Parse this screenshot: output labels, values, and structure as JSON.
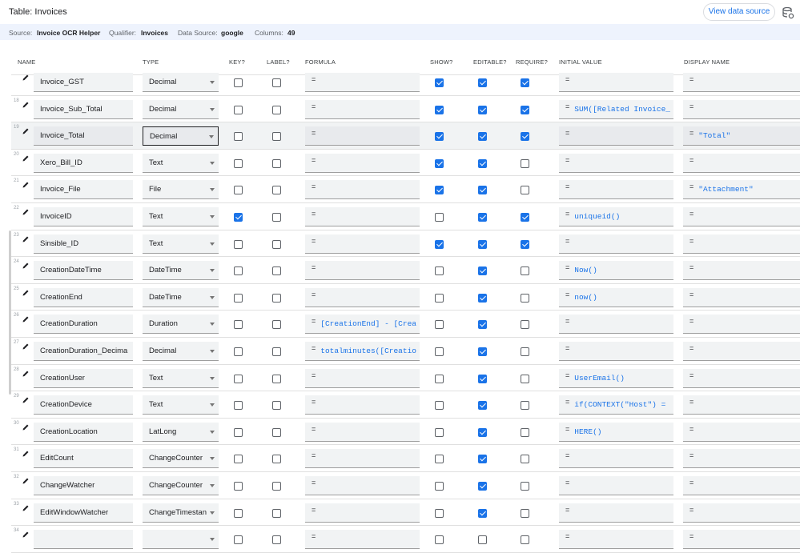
{
  "header": {
    "title": "Table: Invoices",
    "view_data_source": "View data source"
  },
  "info": {
    "source_label": "Source:",
    "source_value": "Invoice OCR Helper",
    "qualifier_label": "Qualifier:",
    "qualifier_value": "Invoices",
    "datasource_label": "Data Source:",
    "datasource_value": "google",
    "columns_label": "Columns:",
    "columns_value": "49"
  },
  "columns": {
    "name": "NAME",
    "type": "TYPE",
    "key": "KEY?",
    "label": "LABEL?",
    "formula": "FORMULA",
    "show": "SHOW?",
    "editable": "EDITABLE?",
    "require": "REQUIRE?",
    "initial": "INITIAL VALUE",
    "display": "DISPLAY NAME"
  },
  "rows": [
    {
      "num": "",
      "name": "Invoice_GST",
      "type": "Decimal",
      "key": false,
      "label": false,
      "formula": "",
      "show": true,
      "editable": true,
      "require": true,
      "initial": "",
      "display": ""
    },
    {
      "num": "18",
      "name": "Invoice_Sub_Total",
      "type": "Decimal",
      "key": false,
      "label": false,
      "formula": "",
      "show": true,
      "editable": true,
      "require": true,
      "initial": "SUM([Related Invoice_",
      "display": ""
    },
    {
      "num": "19",
      "name": "Invoice_Total",
      "type": "Decimal",
      "key": false,
      "label": false,
      "formula": "",
      "show": true,
      "editable": true,
      "require": true,
      "initial": "",
      "display": "\"Total\""
    },
    {
      "num": "20",
      "name": "Xero_Bill_ID",
      "type": "Text",
      "key": false,
      "label": false,
      "formula": "",
      "show": true,
      "editable": true,
      "require": false,
      "initial": "",
      "display": ""
    },
    {
      "num": "21",
      "name": "Invoice_File",
      "type": "File",
      "key": false,
      "label": false,
      "formula": "",
      "show": true,
      "editable": true,
      "require": false,
      "initial": "",
      "display": "\"Attachment\""
    },
    {
      "num": "22",
      "name": "InvoiceID",
      "type": "Text",
      "key": true,
      "label": false,
      "formula": "",
      "show": false,
      "editable": true,
      "require": true,
      "initial": "uniqueid()",
      "display": ""
    },
    {
      "num": "23",
      "name": "Sinsible_ID",
      "type": "Text",
      "key": false,
      "label": false,
      "formula": "",
      "show": true,
      "editable": true,
      "require": true,
      "initial": "",
      "display": ""
    },
    {
      "num": "24",
      "name": "CreationDateTime",
      "type": "DateTime",
      "key": false,
      "label": false,
      "formula": "",
      "show": false,
      "editable": true,
      "require": false,
      "initial": "Now()",
      "display": ""
    },
    {
      "num": "25",
      "name": "CreationEnd",
      "type": "DateTime",
      "key": false,
      "label": false,
      "formula": "",
      "show": false,
      "editable": true,
      "require": false,
      "initial": "now()",
      "display": ""
    },
    {
      "num": "26",
      "name": "CreationDuration",
      "type": "Duration",
      "key": false,
      "label": false,
      "formula": "[CreationEnd] - [Crea",
      "show": false,
      "editable": true,
      "require": false,
      "initial": "",
      "display": ""
    },
    {
      "num": "27",
      "name": "CreationDuration_Decima",
      "type": "Decimal",
      "key": false,
      "label": false,
      "formula": "totalminutes([Creatio",
      "show": false,
      "editable": true,
      "require": false,
      "initial": "",
      "display": ""
    },
    {
      "num": "28",
      "name": "CreationUser",
      "type": "Text",
      "key": false,
      "label": false,
      "formula": "",
      "show": false,
      "editable": true,
      "require": false,
      "initial": "UserEmail()",
      "display": ""
    },
    {
      "num": "29",
      "name": "CreationDevice",
      "type": "Text",
      "key": false,
      "label": false,
      "formula": "",
      "show": false,
      "editable": true,
      "require": false,
      "initial": "if(CONTEXT(\"Host\") =",
      "display": ""
    },
    {
      "num": "30",
      "name": "CreationLocation",
      "type": "LatLong",
      "key": false,
      "label": false,
      "formula": "",
      "show": false,
      "editable": true,
      "require": false,
      "initial": "HERE()",
      "display": ""
    },
    {
      "num": "31",
      "name": "EditCount",
      "type": "ChangeCounter",
      "key": false,
      "label": false,
      "formula": "",
      "show": false,
      "editable": true,
      "require": false,
      "initial": "",
      "display": ""
    },
    {
      "num": "32",
      "name": "ChangeWatcher",
      "type": "ChangeCounter",
      "key": false,
      "label": false,
      "formula": "",
      "show": false,
      "editable": true,
      "require": false,
      "initial": "",
      "display": ""
    },
    {
      "num": "33",
      "name": "EditWindowWatcher",
      "type": "ChangeTimestan",
      "key": false,
      "label": false,
      "formula": "",
      "show": false,
      "editable": true,
      "require": false,
      "initial": "",
      "display": ""
    },
    {
      "num": "34",
      "name": "",
      "type": "",
      "key": false,
      "label": false,
      "formula": "",
      "show": false,
      "editable": false,
      "require": false,
      "initial": "",
      "display": ""
    }
  ],
  "selected_row": 2,
  "accent_color": "#1a73e8"
}
